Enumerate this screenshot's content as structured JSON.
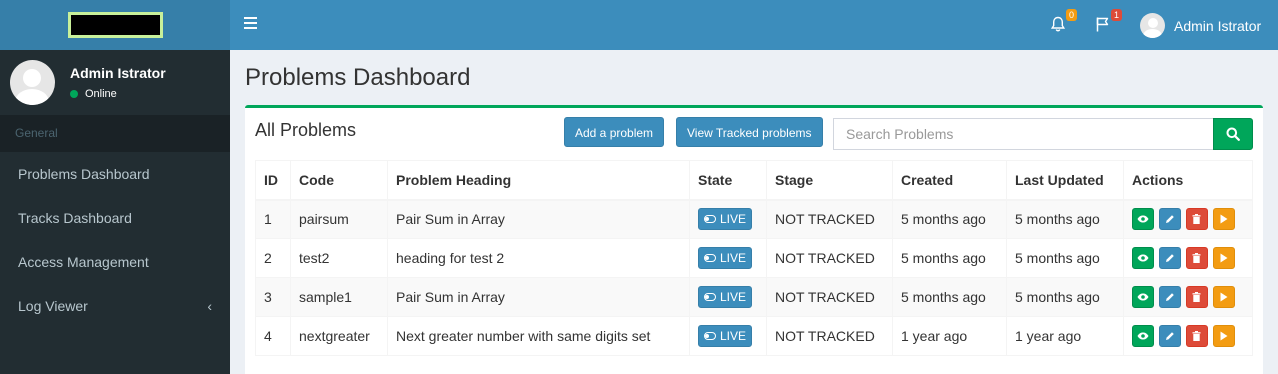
{
  "sidebar": {
    "user_name": "Admin Istrator",
    "user_status": "Online",
    "section_header": "General",
    "items": [
      {
        "label": "Problems Dashboard"
      },
      {
        "label": "Tracks Dashboard"
      },
      {
        "label": "Access Management"
      },
      {
        "label": "Log Viewer",
        "chevron": "‹"
      }
    ]
  },
  "navbar": {
    "notifications_count": "0",
    "flags_count": "1",
    "user_name": "Admin Istrator"
  },
  "page": {
    "title": "Problems Dashboard"
  },
  "box": {
    "title": "All Problems",
    "add_button": "Add a problem",
    "tracked_button": "View Tracked problems",
    "search_placeholder": "Search Problems"
  },
  "table": {
    "headers": [
      "ID",
      "Code",
      "Problem Heading",
      "State",
      "Stage",
      "Created",
      "Last Updated",
      "Actions"
    ],
    "rows": [
      {
        "id": "1",
        "code": "pairsum",
        "heading": "Pair Sum in Array",
        "state": "LIVE",
        "stage": "NOT TRACKED",
        "created": "5 months ago",
        "updated": "5 months ago"
      },
      {
        "id": "2",
        "code": "test2",
        "heading": "heading for test 2",
        "state": "LIVE",
        "stage": "NOT TRACKED",
        "created": "5 months ago",
        "updated": "5 months ago"
      },
      {
        "id": "3",
        "code": "sample1",
        "heading": "Pair Sum in Array",
        "state": "LIVE",
        "stage": "NOT TRACKED",
        "created": "5 months ago",
        "updated": "5 months ago"
      },
      {
        "id": "4",
        "code": "nextgreater",
        "heading": "Next greater number with same digits set",
        "state": "LIVE",
        "stage": "NOT TRACKED",
        "created": "1 year ago",
        "updated": "1 year ago"
      }
    ]
  },
  "colors": {
    "primary": "#3c8dbc",
    "success": "#00a65a",
    "danger": "#dd4b39",
    "warning": "#f39c12",
    "sidebar_bg": "#222d32"
  },
  "icons": [
    "hamburger-icon",
    "bell-icon",
    "flag-icon",
    "search-icon",
    "eye-icon",
    "pencil-icon",
    "trash-icon",
    "play-icon",
    "toggle-icon",
    "chevron-left-icon"
  ]
}
